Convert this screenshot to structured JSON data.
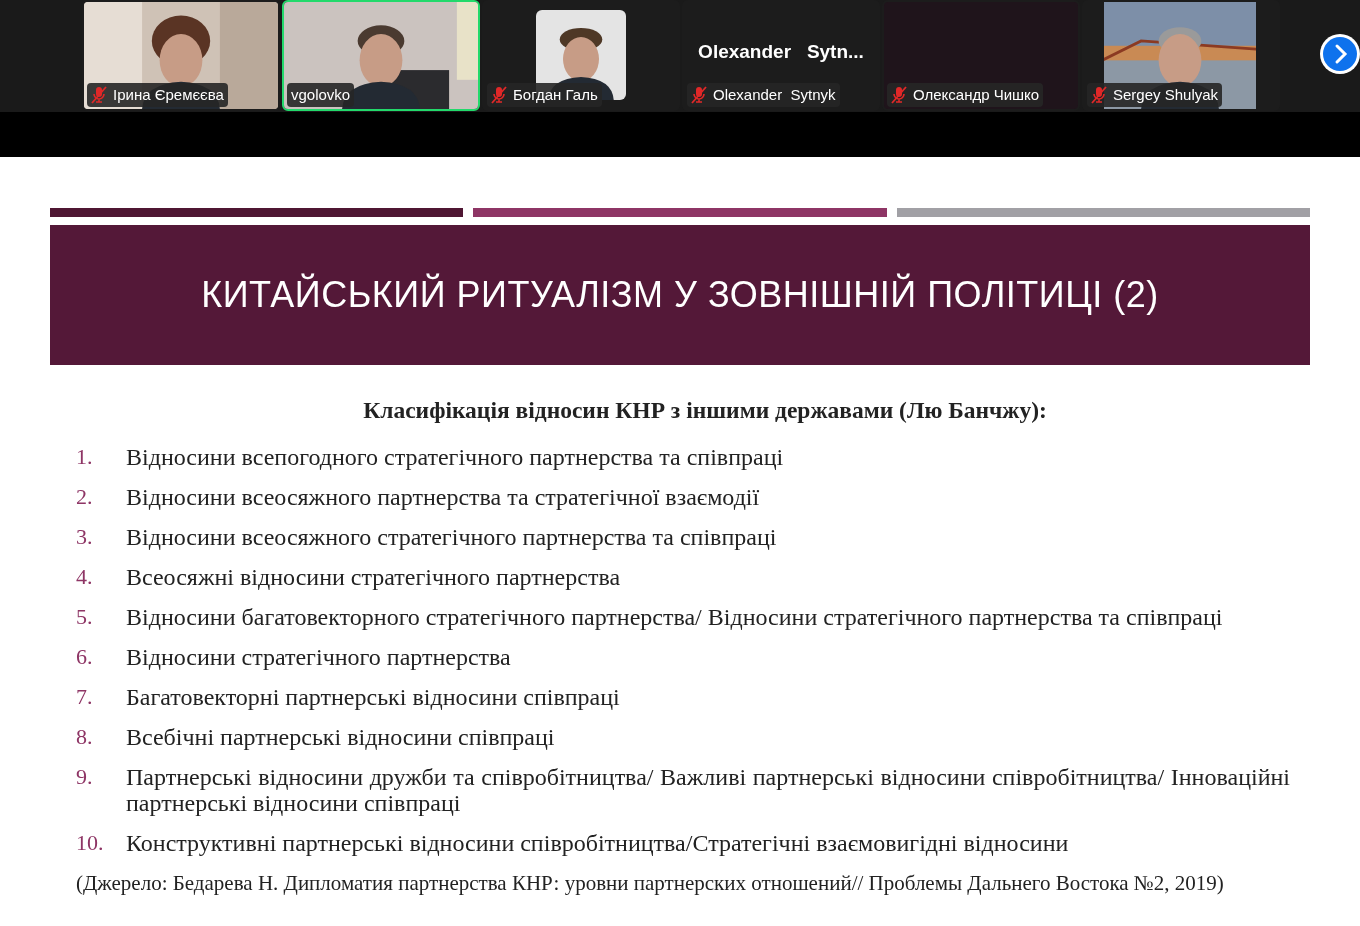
{
  "participants": [
    {
      "kind": "video",
      "name": "Ірина Єремєєва",
      "muted": true,
      "selected": false
    },
    {
      "kind": "video",
      "name": "vgolovko",
      "muted": false,
      "selected": true
    },
    {
      "kind": "avatar",
      "name": "Богдан Галь",
      "muted": true,
      "selected": false
    },
    {
      "kind": "name",
      "display": "Olexander   Sytn...",
      "name": "Olexander  Sytnyk",
      "muted": true,
      "selected": false
    },
    {
      "kind": "blank",
      "name": "Олександр Чишко",
      "muted": true,
      "selected": false
    },
    {
      "name": "Sergey Shulyak",
      "muted": true,
      "selected": false
    }
  ],
  "slide": {
    "title": "КИТАЙСЬКИЙ РИТУАЛІЗМ У ЗОВНІШНІЙ ПОЛІТИЦІ (2)",
    "heading": "Класифікація відносин КНР з іншими державами (Лю Банчжу):",
    "items": [
      {
        "number": "1.",
        "text": "Відносини всепогодного стратегічного партнерства та співпраці"
      },
      {
        "number": "2.",
        "text": "Відносини всеосяжного партнерства та стратегічної взаємодії"
      },
      {
        "number": "3.",
        "text": "Відносини всеосяжного стратегічного партнерства та співпраці"
      },
      {
        "number": "4.",
        "text": "Всеосяжні відносини стратегічного партнерства"
      },
      {
        "number": "5.",
        "text": "Відносини багатовекторного стратегічного партнерства/  Відносини стратегічного партнерства та співпраці"
      },
      {
        "number": "6.",
        "text": "Відносини стратегічного партнерства"
      },
      {
        "number": "7.",
        "text": "Багатовекторні партнерські відносини співпраці"
      },
      {
        "number": "8.",
        "text": "Всебічні партнерські відносини співпраці"
      },
      {
        "number": "9.",
        "text": "Партнерські відносини дружби та співробітництва/ Важливі партнерські відносини співробітництва/ Інноваційні партнерські відносини співпраці"
      },
      {
        "number": "10.",
        "text": "Конструктивні партнерські відносини співробітництва/Стратегічні взаємовигідні відносини"
      }
    ],
    "source": "(Джерело: Бедарева Н. Дипломатия партнерства КНР: уровни партнерских отношений// Проблемы Дальнего Востока №2, 2019)"
  }
}
